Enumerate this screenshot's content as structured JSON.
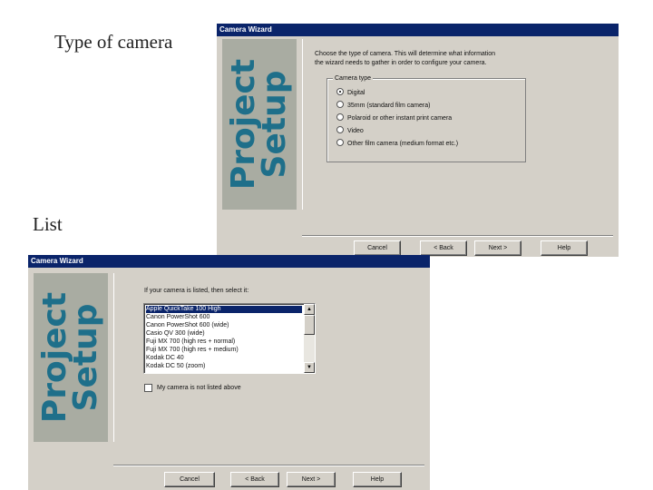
{
  "slide": {
    "label_top": "Type of camera",
    "label_bottom": "List"
  },
  "window1": {
    "title": "Camera Wizard",
    "banner_line1": "Project",
    "banner_line2": "Setup",
    "instruction_line1": "Choose the type of camera. This will determine what information",
    "instruction_line2": "the wizard needs to gather in order to configure your camera.",
    "group_label": "Camera type",
    "options": [
      {
        "label": "Digital",
        "checked": true
      },
      {
        "label": "35mm (standard film camera)",
        "checked": false
      },
      {
        "label": "Polaroid or other instant print camera",
        "checked": false
      },
      {
        "label": "Video",
        "checked": false
      },
      {
        "label": "Other film camera (medium format etc.)",
        "checked": false
      }
    ],
    "buttons": {
      "cancel": "Cancel",
      "back": "< Back",
      "next": "Next >",
      "help": "Help"
    }
  },
  "window2": {
    "title": "Camera Wizard",
    "banner_line1": "Project",
    "banner_line2": "Setup",
    "instruction": "If your camera is listed, then select it:",
    "camera_list": [
      "Apple QuickTake 100 High",
      "Canon PowerShot 600",
      "Canon PowerShot 600 (wide)",
      "Casio QV 300 (wide)",
      "Fuji MX 700 (high res + normal)",
      "Fuji MX 700 (high res + medium)",
      "Kodak DC 40",
      "Kodak DC 50 (zoom)"
    ],
    "selected_index": 0,
    "checkbox_label": "My camera is not listed above",
    "checkbox_checked": false,
    "buttons": {
      "cancel": "Cancel",
      "back": "< Back",
      "next": "Next >",
      "help": "Help"
    }
  },
  "colors": {
    "title_bar": "#0a246a",
    "dialog_bg": "#d4d0c8",
    "banner_bg": "#a9aca2",
    "banner_text": "#1e6f8a",
    "selection": "#0a246a"
  }
}
